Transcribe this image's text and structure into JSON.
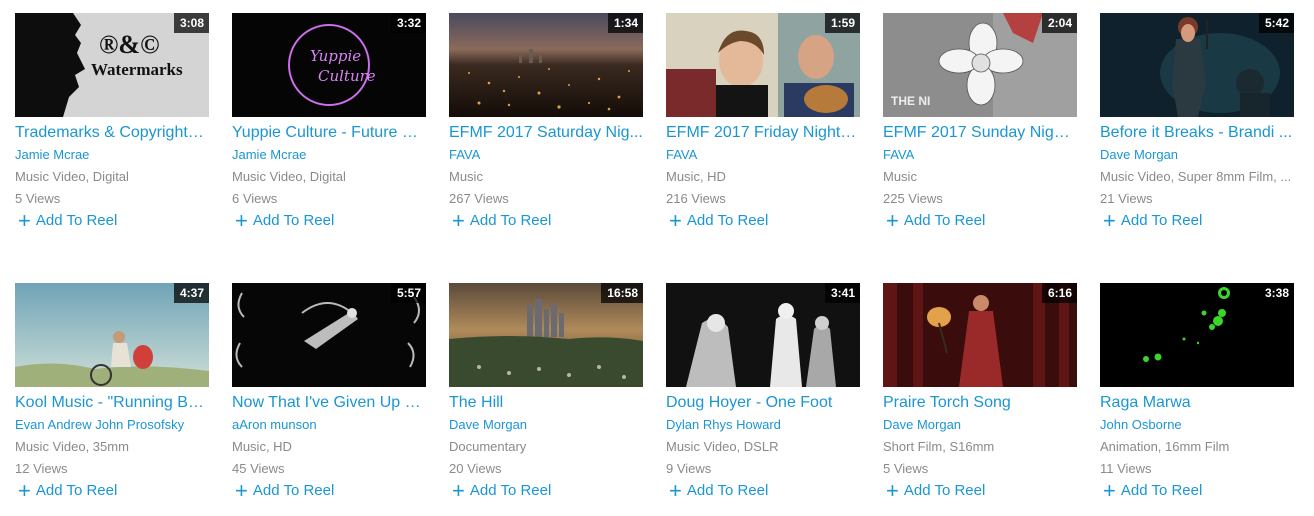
{
  "add_label": "Add To Reel",
  "thumb_text": {
    "watermark_symbols": "®&©",
    "watermark_word": "Watermarks",
    "yuppie_line1": "Yuppie",
    "yuppie_line2": "Culture",
    "sunday_overlay": "THE NI"
  },
  "videos": [
    {
      "title": "Trademarks & Copyrights ...",
      "author": "Jamie Mcrae",
      "meta": "Music Video, Digital",
      "views": "5 Views",
      "duration": "3:08"
    },
    {
      "title": "Yuppie Culture - Future Fe...",
      "author": "Jamie Mcrae",
      "meta": "Music Video, Digital",
      "views": "6 Views",
      "duration": "3:32"
    },
    {
      "title": "EFMF 2017 Saturday Nig...",
      "author": "FAVA",
      "meta": "Music",
      "views": "267 Views",
      "duration": "1:34"
    },
    {
      "title": "EFMF 2017 Friday NightC...",
      "author": "FAVA",
      "meta": "Music, HD",
      "views": "216 Views",
      "duration": "1:59"
    },
    {
      "title": "EFMF 2017 Sunday Night ...",
      "author": "FAVA",
      "meta": "Music",
      "views": "225 Views",
      "duration": "2:04"
    },
    {
      "title": "Before it Breaks - Brandi ...",
      "author": "Dave Morgan",
      "meta": "Music Video, Super 8mm Film, ...",
      "views": "21 Views",
      "duration": "5:42"
    },
    {
      "title": "Kool Music - \"Running Ba...",
      "author": "Evan Andrew John Prosofsky",
      "meta": "Music Video, 35mm",
      "views": "12 Views",
      "duration": "4:37"
    },
    {
      "title": "Now That I've Given Up H...",
      "author": "aAron munson",
      "meta": "Music, HD",
      "views": "45 Views",
      "duration": "5:57"
    },
    {
      "title": "The Hill",
      "author": "Dave Morgan",
      "meta": "Documentary",
      "views": "20 Views",
      "duration": "16:58"
    },
    {
      "title": "Doug Hoyer - One Foot",
      "author": "Dylan Rhys Howard",
      "meta": "Music Video, DSLR",
      "views": "9 Views",
      "duration": "3:41"
    },
    {
      "title": "Praire Torch Song",
      "author": "Dave Morgan",
      "meta": "Short Film, S16mm",
      "views": "5 Views",
      "duration": "6:16"
    },
    {
      "title": "Raga Marwa",
      "author": "John Osborne",
      "meta": "Animation, 16mm Film",
      "views": "11 Views",
      "duration": "3:38"
    }
  ]
}
